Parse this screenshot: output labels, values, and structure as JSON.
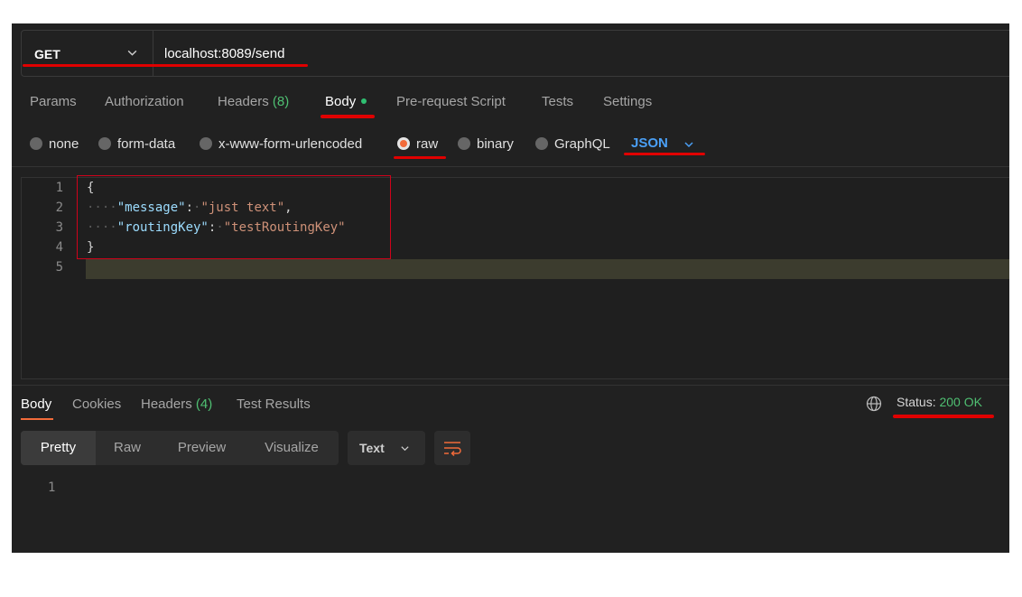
{
  "request": {
    "method": "GET",
    "url": "localhost:8089/send"
  },
  "request_tabs": [
    {
      "label": "Params"
    },
    {
      "label": "Authorization"
    },
    {
      "label": "Headers",
      "count": "(8)"
    },
    {
      "label": "Body"
    },
    {
      "label": "Pre-request Script"
    },
    {
      "label": "Tests"
    },
    {
      "label": "Settings"
    }
  ],
  "body_types": {
    "none": "none",
    "form_data": "form-data",
    "urlencoded": "x-www-form-urlencoded",
    "raw": "raw",
    "binary": "binary",
    "graphql": "GraphQL",
    "selected": "raw",
    "language": "JSON"
  },
  "editor": {
    "line_numbers": [
      "1",
      "2",
      "3",
      "4",
      "5"
    ],
    "open_brace": "{",
    "close_brace": "}",
    "message_key": "\"message\"",
    "message_value": "\"just text\"",
    "routing_key": "\"routingKey\"",
    "routing_value": "\"testRoutingKey\""
  },
  "response": {
    "tabs": [
      {
        "label": "Body"
      },
      {
        "label": "Cookies"
      },
      {
        "label": "Headers",
        "count": "(4)"
      },
      {
        "label": "Test Results"
      }
    ],
    "status_label": "Status:",
    "status_value": "200 OK",
    "views": [
      "Pretty",
      "Raw",
      "Preview",
      "Visualize"
    ],
    "format": "Text",
    "line_number": "1"
  },
  "colors": {
    "background": "#212121",
    "accent_orange": "#f26b3a",
    "json_blue": "#4a9ff5",
    "success_green": "#4fbf72",
    "annotation_red": "#e00000"
  },
  "icons": [
    "chevron-down-icon",
    "globe-icon",
    "wrap-lines-icon"
  ]
}
